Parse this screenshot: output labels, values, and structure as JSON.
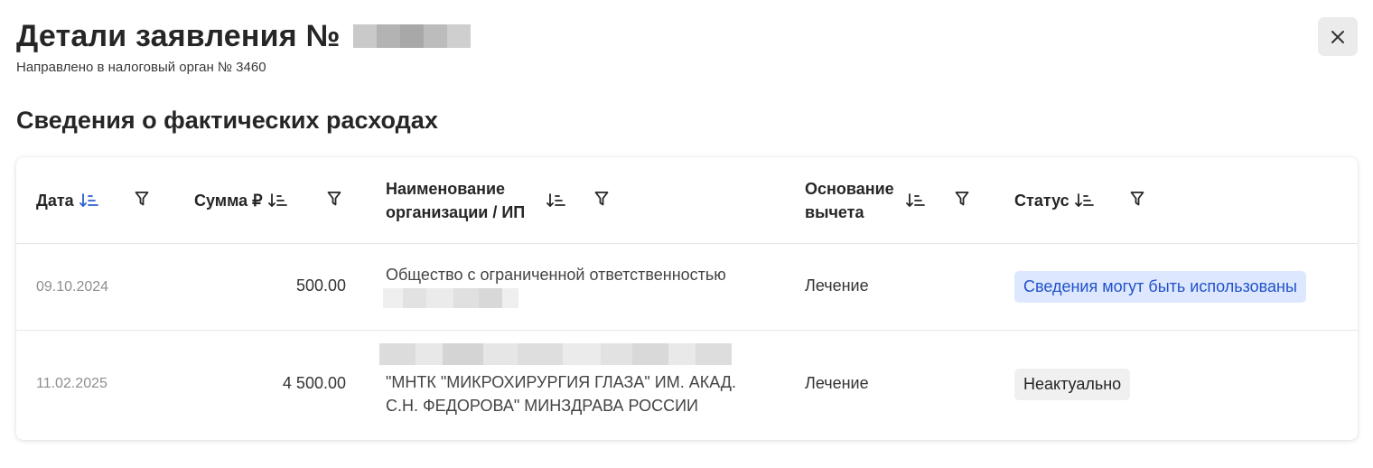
{
  "header": {
    "title": "Детали заявления №",
    "subtitle": "Направлено в налоговый орган № 3460"
  },
  "section": {
    "title": "Сведения о фактических расходах"
  },
  "table": {
    "columns": [
      {
        "label": "Дата"
      },
      {
        "label": "Сумма ₽"
      },
      {
        "label": "Наименование организации / ИП"
      },
      {
        "label": "Основание вычета"
      },
      {
        "label": "Статус"
      }
    ],
    "rows": [
      {
        "date": "09.10.2024",
        "amount": "500.00",
        "org": "Общество с ограниченной ответственностью",
        "basis": "Лечение",
        "status": "Сведения могут быть использованы"
      },
      {
        "date": "11.02.2025",
        "amount": "4 500.00",
        "org_line1": "\"МНТК \"МИКРОХИРУРГИЯ ГЛАЗА\" ИМ. АКАД.",
        "org_line2": "С.Н. ФЕДОРОВА\" МИНЗДРАВА РОССИИ",
        "basis": "Лечение",
        "status": "Неактуально"
      }
    ]
  },
  "colors": {
    "status_blue_bg": "#dde8ff",
    "status_blue_text": "#2252c8",
    "status_gray_bg": "#f0f0f0",
    "active_sort": "#2b5fd1"
  },
  "icons": [
    "close-icon",
    "sort-icon",
    "filter-icon"
  ]
}
